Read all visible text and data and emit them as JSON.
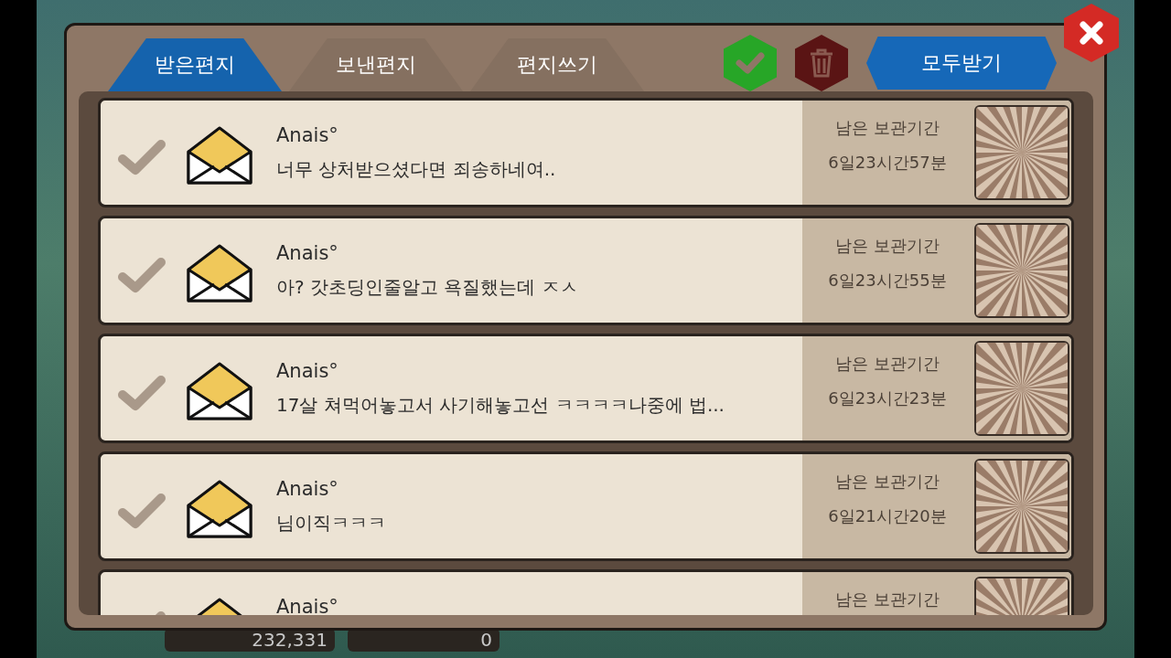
{
  "tabs": [
    {
      "label": "받은편지",
      "selected": true
    },
    {
      "label": "보낸편지",
      "selected": false
    },
    {
      "label": "편지쓰기",
      "selected": false
    }
  ],
  "claim_all_button": "모두받기",
  "mails": [
    {
      "sender": "Anais°",
      "message": "너무 상처받으셨다면 죄송하네여..",
      "retention_label": "남은 보관기간",
      "remaining": "6일23시간57분",
      "checked": false
    },
    {
      "sender": "Anais°",
      "message": "아? 갓초딩인줄알고 욕질했는데 ㅈㅅ",
      "retention_label": "남은 보관기간",
      "remaining": "6일23시간55분",
      "checked": false
    },
    {
      "sender": "Anais°",
      "message": "17살 쳐먹어놓고서 사기해놓고선 ㅋㅋㅋㅋ나중에 법...",
      "retention_label": "남은 보관기간",
      "remaining": "6일23시간23분",
      "checked": false
    },
    {
      "sender": "Anais°",
      "message": "님이직ㅋㅋㅋ",
      "retention_label": "남은 보관기간",
      "remaining": "6일21시간20분",
      "checked": false
    },
    {
      "sender": "Anais°",
      "retention_label": "남은 보관기간",
      "checked": false
    }
  ],
  "hud": {
    "gold": "232,331",
    "gems": "0"
  }
}
